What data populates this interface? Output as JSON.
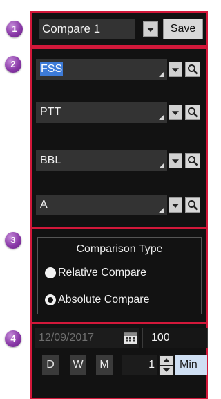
{
  "badges": [
    "1",
    "2",
    "3",
    "4"
  ],
  "section1": {
    "compare_value": "Compare 1",
    "save_label": "Save"
  },
  "section2": {
    "symbols": [
      "FSS",
      "PTT",
      "BBL",
      "A"
    ]
  },
  "section3": {
    "title": "Comparison Type",
    "options": [
      {
        "label": "Relative Compare",
        "selected": true
      },
      {
        "label": "Absolute Compare",
        "selected": false
      }
    ]
  },
  "section4": {
    "date": "12/09/2017",
    "count": "100",
    "periods": [
      "D",
      "W",
      "M"
    ],
    "interval": "1",
    "unit": "Min"
  },
  "colors": {
    "panel_border": "#d2183a",
    "badge": "#8a3aa8",
    "selection": "#3d7bd8"
  }
}
